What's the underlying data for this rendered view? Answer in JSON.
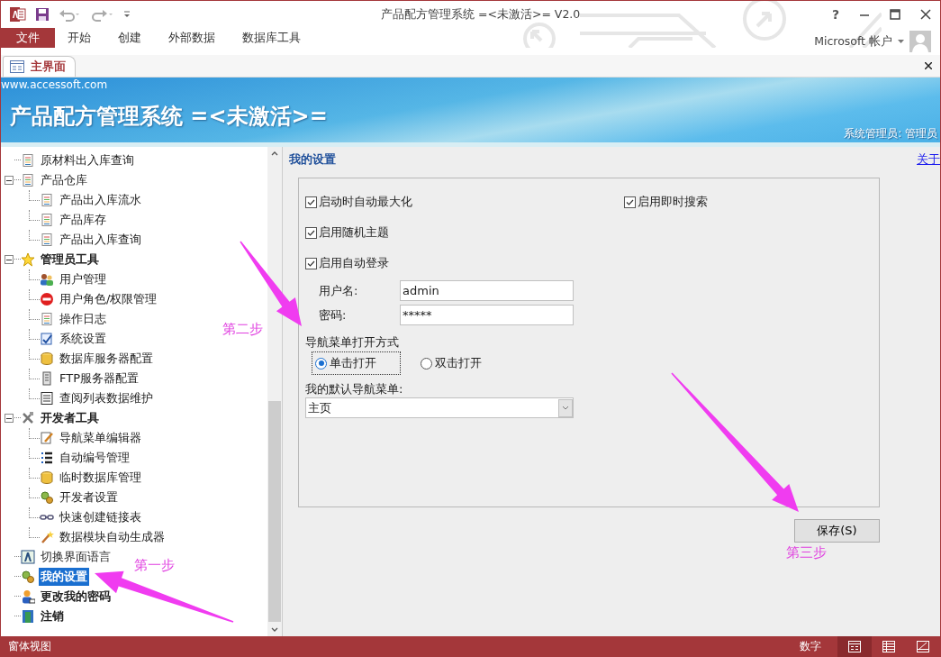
{
  "window": {
    "title": "产品配方管理系统 =<未激活>= V2.0",
    "help": "?"
  },
  "ribbon_tabs": [
    {
      "label": "文件",
      "kind": "backstage",
      "selected": false
    },
    {
      "label": "开始",
      "kind": "tab",
      "selected": false
    },
    {
      "label": "创建",
      "kind": "tab",
      "selected": false
    },
    {
      "label": "外部数据",
      "kind": "tab",
      "selected": false
    },
    {
      "label": "数据库工具",
      "kind": "tab",
      "selected": false
    }
  ],
  "account": {
    "label": "Microsoft 帐户"
  },
  "document_tab": {
    "label": "主界面"
  },
  "banner": {
    "site": "www.accessoft.com",
    "title": "产品配方管理系统 =<未激活>=",
    "user": "系统管理员: 管理员"
  },
  "tree": [
    {
      "label": "原材料出入库查询",
      "selected": false,
      "bold": false
    },
    {
      "label": "产品仓库",
      "selected": false,
      "bold": false,
      "expanded": true,
      "children": [
        {
          "label": "产品出入库流水",
          "selected": false
        },
        {
          "label": "产品库存",
          "selected": false
        },
        {
          "label": "产品出入库查询",
          "selected": false
        }
      ]
    },
    {
      "label": "管理员工具",
      "selected": false,
      "bold": true,
      "expanded": true,
      "children": [
        {
          "label": "用户管理",
          "selected": false
        },
        {
          "label": "用户角色/权限管理",
          "selected": false
        },
        {
          "label": "操作日志",
          "selected": false
        },
        {
          "label": "系统设置",
          "selected": false
        },
        {
          "label": "数据库服务器配置",
          "selected": false
        },
        {
          "label": "FTP服务器配置",
          "selected": false
        },
        {
          "label": "查阅列表数据维护",
          "selected": false
        }
      ]
    },
    {
      "label": "开发者工具",
      "selected": false,
      "bold": true,
      "expanded": true,
      "children": [
        {
          "label": "导航菜单编辑器",
          "selected": false
        },
        {
          "label": "自动编号管理",
          "selected": false
        },
        {
          "label": "临时数据库管理",
          "selected": false
        },
        {
          "label": "开发者设置",
          "selected": false
        },
        {
          "label": "快速创建链接表",
          "selected": false
        },
        {
          "label": "数据模块自动生成器",
          "selected": false
        }
      ]
    },
    {
      "label": "切换界面语言",
      "selected": false,
      "bold": false
    },
    {
      "label": "我的设置",
      "selected": true,
      "bold": true
    },
    {
      "label": "更改我的密码",
      "selected": false,
      "bold": true
    },
    {
      "label": "注销",
      "selected": false,
      "bold": true
    }
  ],
  "settings": {
    "title": "我的设置",
    "about_link": "关于",
    "checkboxes": [
      {
        "label": "启动时自动最大化",
        "checked": true
      },
      {
        "label": "启用即时搜索",
        "checked": true
      },
      {
        "label": "启用随机主题",
        "checked": true
      },
      {
        "label": "启用自动登录",
        "checked": true
      }
    ],
    "fields": [
      {
        "label": "用户名:",
        "value": "admin"
      },
      {
        "label": "密码:",
        "value": "*****"
      }
    ],
    "open_mode": {
      "label": "导航菜单打开方式",
      "options": [
        {
          "label": "单击打开",
          "selected": true
        },
        {
          "label": "双击打开",
          "selected": false
        }
      ]
    },
    "default_menu": {
      "label": "我的默认导航菜单:",
      "value": "主页"
    },
    "save_button": "保存(S)"
  },
  "annotations": [
    {
      "label": "第一步"
    },
    {
      "label": "第二步"
    },
    {
      "label": "第三步"
    }
  ],
  "status_bar": {
    "view": "窗体视图",
    "mode": "数字",
    "views": [
      {
        "selected": true
      },
      {
        "selected": false
      },
      {
        "selected": false
      }
    ]
  }
}
